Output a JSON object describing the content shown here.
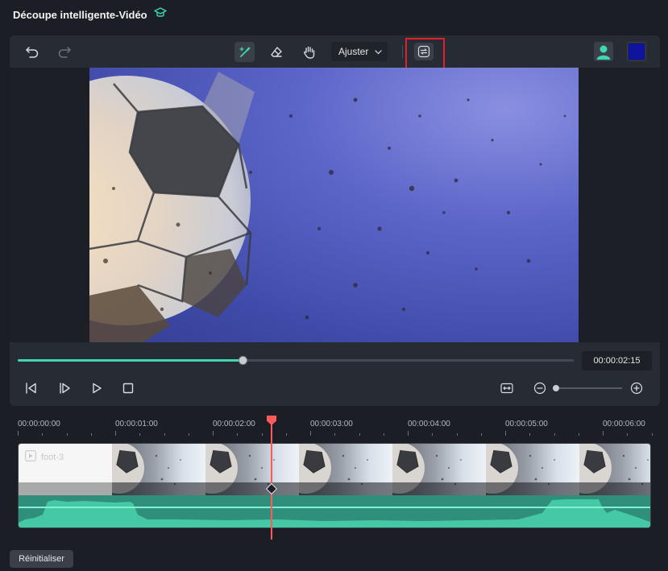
{
  "window": {
    "title": "Découpe intelligente-Vidéo",
    "title_icon": "graduation-cap-icon"
  },
  "toolbar": {
    "undo_icon": "undo-icon",
    "redo_icon": "redo-icon",
    "tools": [
      {
        "name": "smart-brush",
        "icon": "magic-brush-icon",
        "active": true
      },
      {
        "name": "eraser",
        "icon": "eraser-icon",
        "active": false
      },
      {
        "name": "hand",
        "icon": "hand-icon",
        "active": false
      }
    ],
    "fit_dropdown": {
      "label": "Ajuster"
    },
    "swap_button_icon": "swap-arrows-icon",
    "person_icon": "person-icon",
    "color_swatch": "#0f149e"
  },
  "player": {
    "progress": 0.404,
    "timecode": "00:00:02:15",
    "zoom_level": 0.0
  },
  "timeline": {
    "ruler_labels": [
      "00:00:00:00",
      "00:00:01:00",
      "00:00:02:00",
      "00:00:03:00",
      "00:00:04:00",
      "00:00:05:00",
      "00:00:06:00"
    ],
    "clip_name": "foot-3",
    "playhead_fraction": 0.402
  },
  "footer": {
    "reset_label": "Réinitialiser"
  },
  "colors": {
    "accent": "#3fd6b0",
    "playhead": "#ff5a5a",
    "highlight_box": "#e0202a"
  }
}
